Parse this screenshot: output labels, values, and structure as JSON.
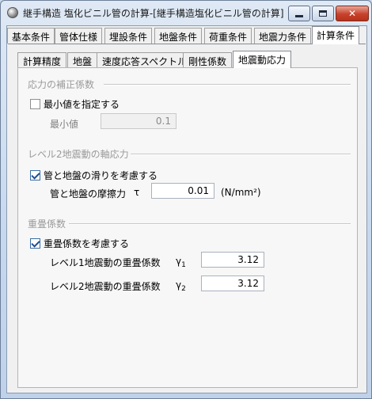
{
  "window": {
    "title": "継手構造 塩化ビニル管の計算-[継手構造塩化ビニル管の計算]",
    "minimize_icon": "minimize-icon",
    "maximize_icon": "maximize-icon",
    "close_glyph": "✕"
  },
  "main_tabs": [
    "基本条件",
    "管体仕様",
    "埋設条件",
    "地盤条件",
    "荷重条件",
    "地震力条件",
    "計算条件"
  ],
  "sub_tabs": [
    "計算精度",
    "地盤",
    "速度応答スペクトル",
    "剛性係数",
    "地震動応力"
  ],
  "sections": {
    "correction": {
      "title": "応力の補正係数",
      "checkbox_label": "最小値を指定する",
      "checked": false,
      "min_label": "最小値",
      "min_value": "0.1"
    },
    "axial": {
      "title": "レベル2地震動の軸応力",
      "checkbox_label": "管と地盤の滑りを考慮する",
      "checked": true,
      "friction_label": "管と地盤の摩擦力",
      "tau_symbol": "τ",
      "friction_value": "0.01",
      "friction_unit": "(N/mm²)"
    },
    "overlap": {
      "title": "重畳係数",
      "checkbox_label": "重畳係数を考慮する",
      "checked": true,
      "level1_label": "レベル1地震動の重畳係数",
      "level1_symbol": "γ",
      "level1_sub": "1",
      "level1_value": "3.12",
      "level2_label": "レベル2地震動の重畳係数",
      "level2_symbol": "γ",
      "level2_sub": "2",
      "level2_value": "3.12"
    }
  }
}
